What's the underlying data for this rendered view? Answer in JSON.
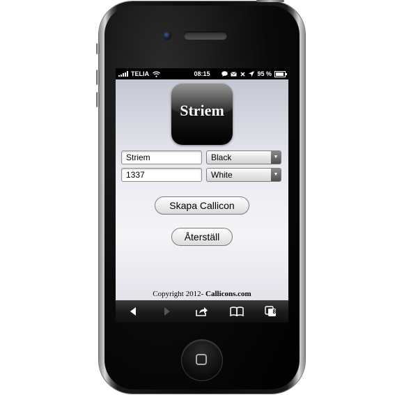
{
  "status_bar": {
    "carrier": "TELIA",
    "time": "08:15",
    "battery_percent": "95 %",
    "battery_level": 0.95
  },
  "app": {
    "icon_label": "Striem",
    "name_input": {
      "value": "Striem"
    },
    "number_input": {
      "value": "1337"
    },
    "color_select_1": {
      "selected": "Black"
    },
    "color_select_2": {
      "selected": "White"
    },
    "create_button_label": "Skapa Callicon",
    "reset_button_label": "Återställ",
    "copyright_prefix": "Copyright 2012- ",
    "copyright_brand": "Callicons.com"
  },
  "toolbar": {
    "tab_count": "8"
  },
  "colors": {
    "icon_background": "#000000",
    "page_gradient_top": "#c4c7d3"
  }
}
